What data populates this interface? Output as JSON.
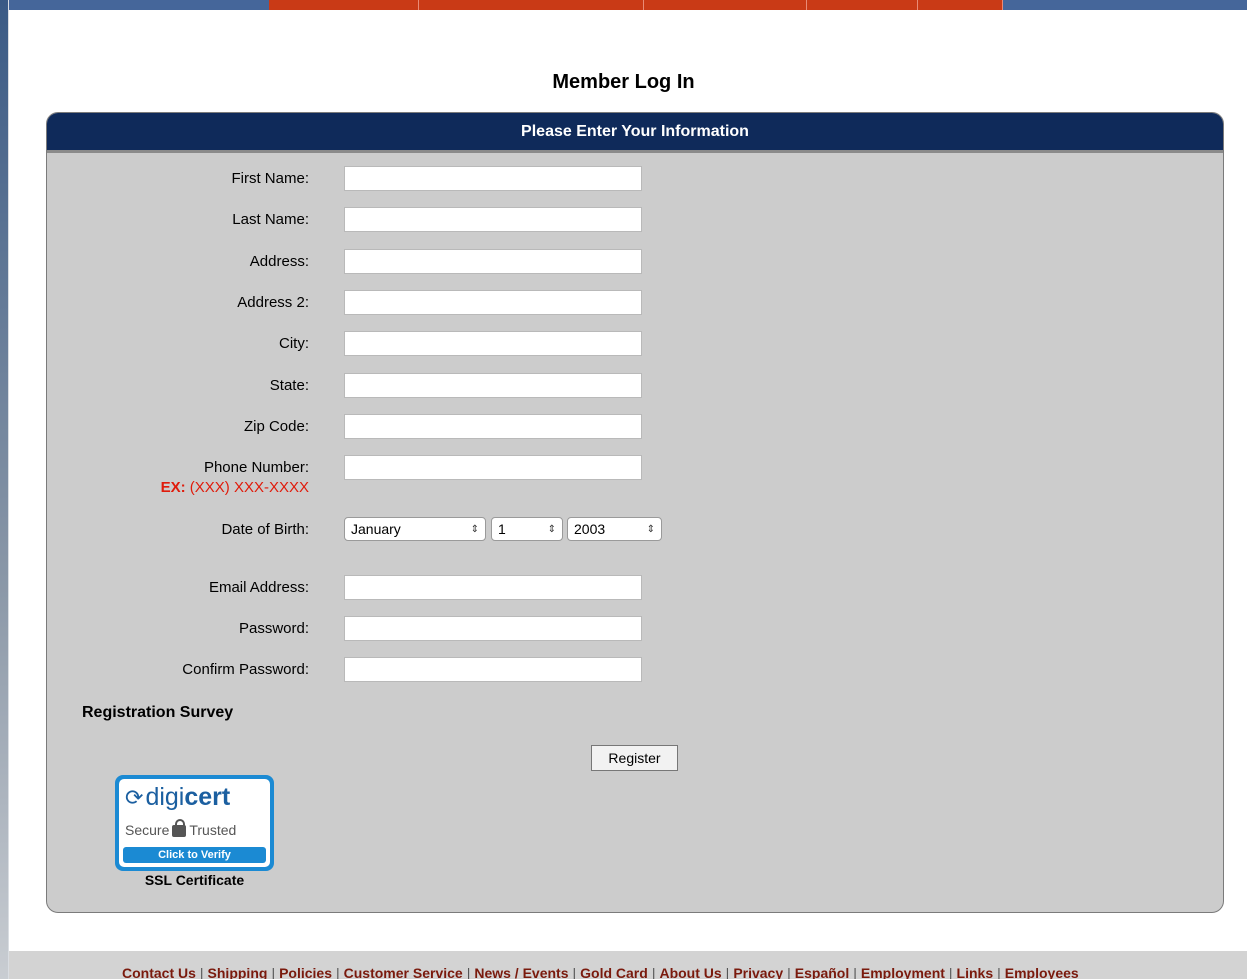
{
  "page": {
    "title": "Member Log In"
  },
  "form": {
    "header": "Please Enter Your Information",
    "fields": {
      "first_name": {
        "label": "First Name:",
        "value": ""
      },
      "last_name": {
        "label": "Last Name:",
        "value": ""
      },
      "address": {
        "label": "Address:",
        "value": ""
      },
      "address2": {
        "label": "Address 2:",
        "value": ""
      },
      "city": {
        "label": "City:",
        "value": ""
      },
      "state": {
        "label": "State:",
        "value": ""
      },
      "zip": {
        "label": "Zip Code:",
        "value": ""
      },
      "phone": {
        "label": "Phone Number:",
        "example_prefix": "EX:",
        "example_format": "(XXX) XXX-XXXX",
        "value": ""
      },
      "dob": {
        "label": "Date of Birth:",
        "month": "January",
        "day": "1",
        "year": "2003"
      },
      "email": {
        "label": "Email Address:",
        "value": ""
      },
      "password": {
        "label": "Password:",
        "value": ""
      },
      "confirm_password": {
        "label": "Confirm Password:",
        "value": ""
      }
    },
    "survey_heading": "Registration Survey",
    "register_label": "Register"
  },
  "seal": {
    "brand_light": "digi",
    "brand_bold": "cert",
    "secure": "Secure",
    "trusted": "Trusted",
    "verify": "Click to Verify",
    "caption": "SSL Certificate",
    "icon": "lock-icon"
  },
  "footer": {
    "links": [
      "Contact Us",
      "Shipping",
      "Policies",
      "Customer Service",
      "News / Events",
      "Gold Card",
      "About Us",
      "Privacy",
      "Español",
      "Employment",
      "Links",
      "Employees"
    ],
    "separator": "|"
  },
  "colors": {
    "header_navy": "#0f2a5a",
    "panel_gray": "#cccccc",
    "example_red": "#e01b0b",
    "top_bar_red": "#c93a16",
    "top_bar_blue": "#45669a",
    "seal_blue": "#1b8ad3",
    "footer_link": "#7a1a0d"
  }
}
